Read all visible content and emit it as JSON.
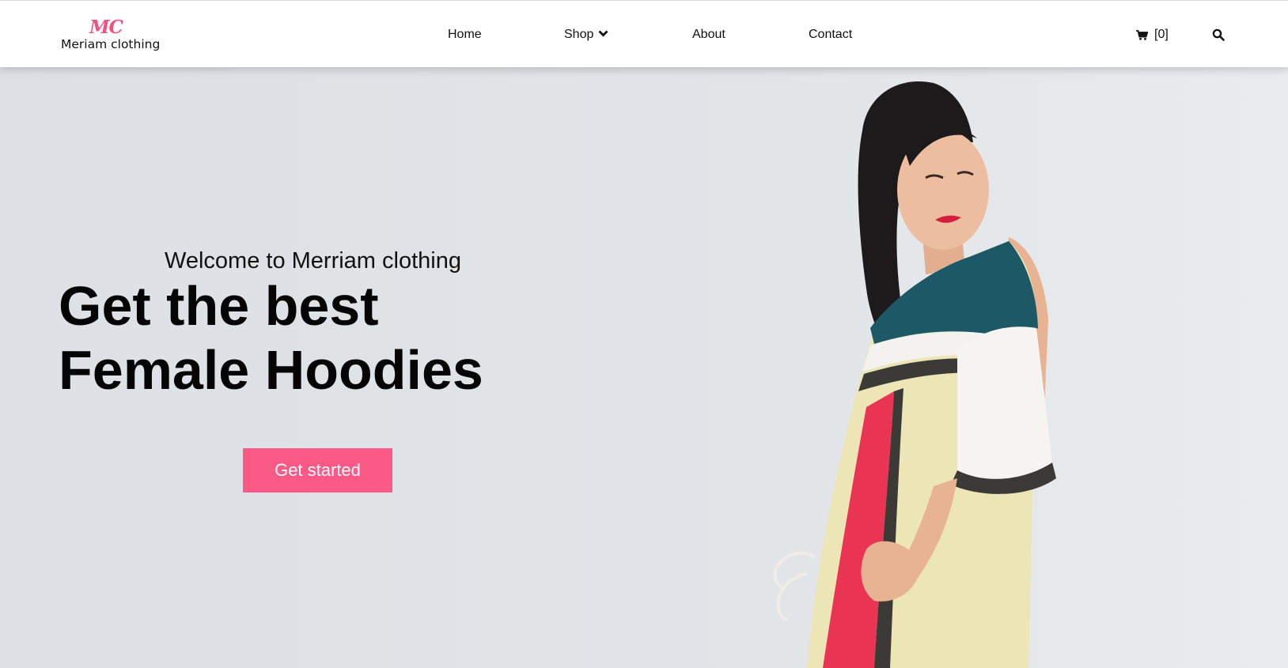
{
  "brand": {
    "mark": "MC",
    "name": "Meriam clothing",
    "accent_color": "#f0517f"
  },
  "nav": {
    "items": [
      {
        "label": "Home"
      },
      {
        "label": "Shop",
        "icon": "chevron-down-icon"
      },
      {
        "label": "About"
      },
      {
        "label": "Contact"
      }
    ],
    "cart": {
      "icon": "cart-icon",
      "count_label": "[0]"
    },
    "search": {
      "icon": "search-icon"
    }
  },
  "hero": {
    "welcome": "Welcome to Merriam clothing",
    "headline_line1": "Get the best",
    "headline_line2": "Female Hoodies",
    "cta_label": "Get started",
    "cta_color": "#fb5a86",
    "background_color": "#dfe3e6"
  }
}
